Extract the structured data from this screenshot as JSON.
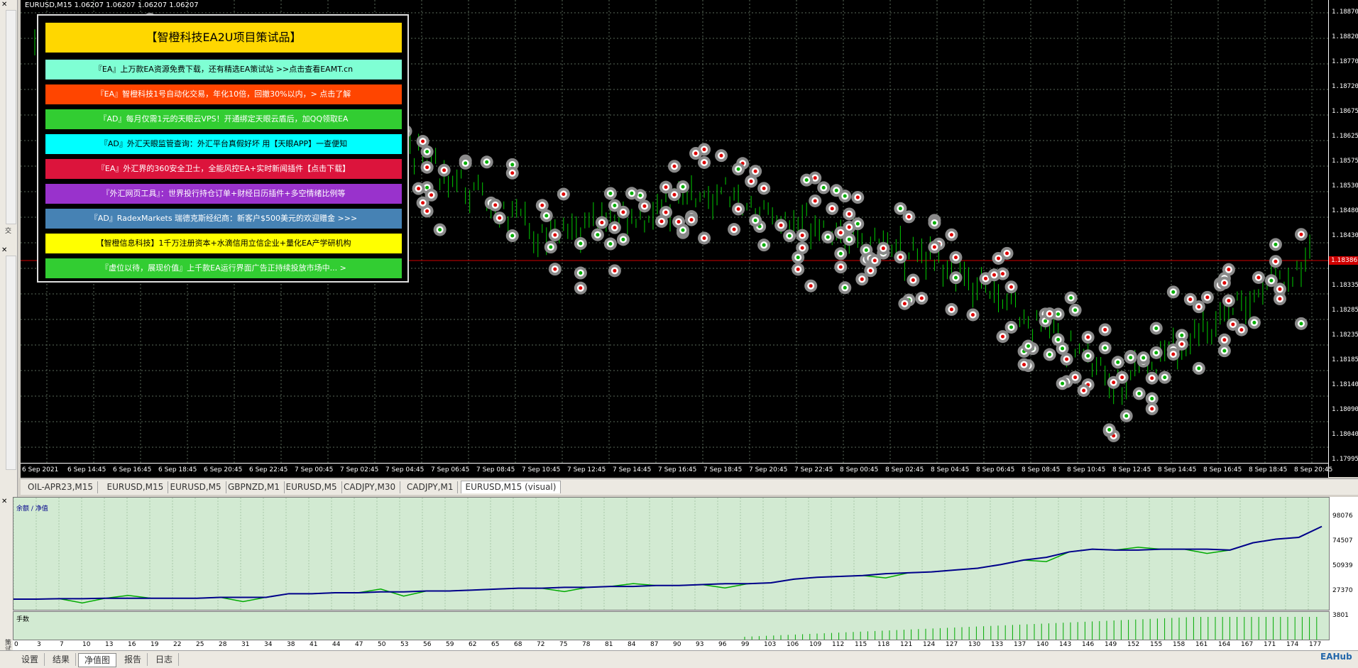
{
  "chart": {
    "title": "EURUSD,M15  1.06207 1.06207 1.06207 1.06207",
    "price_labels": [
      "1.18870",
      "1.18820",
      "1.18770",
      "1.18720",
      "1.18675",
      "1.18625",
      "1.18575",
      "1.18530",
      "1.18480",
      "1.18430",
      "1.18385",
      "1.18335",
      "1.18285",
      "1.18235",
      "1.18185",
      "1.18140",
      "1.18090",
      "1.18040",
      "1.17995"
    ],
    "current_price": "1.18386",
    "time_labels": [
      "6 Sep 2021",
      "6 Sep 14:45",
      "6 Sep 16:45",
      "6 Sep 18:45",
      "6 Sep 20:45",
      "6 Sep 22:45",
      "7 Sep 00:45",
      "7 Sep 02:45",
      "7 Sep 04:45",
      "7 Sep 06:45",
      "7 Sep 08:45",
      "7 Sep 10:45",
      "7 Sep 12:45",
      "7 Sep 14:45",
      "7 Sep 16:45",
      "7 Sep 18:45",
      "7 Sep 20:45",
      "7 Sep 22:45",
      "8 Sep 00:45",
      "8 Sep 02:45",
      "8 Sep 04:45",
      "8 Sep 06:45",
      "8 Sep 08:45",
      "8 Sep 10:45",
      "8 Sep 12:45",
      "8 Sep 14:45",
      "8 Sep 16:45",
      "8 Sep 18:45",
      "8 Sep 20:45"
    ],
    "colors": {
      "background": "#000000",
      "candle": "#00cc00",
      "grid": "#5a6a5a",
      "current_line": "#d00000"
    }
  },
  "ads": {
    "header": "【智橙科技EA2U项目策试品】",
    "rows": [
      {
        "text": "『EA』上万款EA资源免费下载，还有精选EA策试站 >>点击查看EAMT.cn",
        "bg": "#7fffd4",
        "fg": "#000000"
      },
      {
        "text": "『EA』智橙科技1号自动化交易，年化10倍，回撤30%以内，> 点击了解",
        "bg": "#ff4500",
        "fg": "#ffffff"
      },
      {
        "text": "『AD』每月仅需1元的天眼云VPS！开通绑定天眼云盾后，加QQ领取EA",
        "bg": "#32cd32",
        "fg": "#ffffff"
      },
      {
        "text": "『AD』外汇天眼监管查询：外汇平台真假好坏 用【天眼APP】一查便知",
        "bg": "#00ffff",
        "fg": "#000000"
      },
      {
        "text": "『EA』外汇界的360安全卫士，全能风控EA+实时新闻插件【点击下载】",
        "bg": "#dc143c",
        "fg": "#ffffff"
      },
      {
        "text": "『外汇网页工具』：世界投行持仓订单+财经日历插件+多空情绪比例等",
        "bg": "#9932cc",
        "fg": "#ffffff"
      },
      {
        "text": "『AD』RadexMarkets 瑞德克斯经纪商：新客户$500美元的欢迎赠金 >>>",
        "bg": "#4682b4",
        "fg": "#ffffff"
      },
      {
        "text": "【智橙信息科技】1千万注册资本+水滴信用立信企业+量化EA产学研机构",
        "bg": "#ffff00",
        "fg": "#000000"
      },
      {
        "text": "『虚位以待，展现价值』上千款EA运行界面广告正持续投放市场中... >",
        "bg": "#32cd32",
        "fg": "#ffffff"
      }
    ]
  },
  "tabs": [
    {
      "label": "OIL-APR23,M15",
      "active": false
    },
    {
      "label": "EURUSD,M15",
      "active": false
    },
    {
      "label": "EURUSD,M5",
      "active": false
    },
    {
      "label": "GBPNZD,M1",
      "active": false
    },
    {
      "label": "EURUSD,M5",
      "active": false
    },
    {
      "label": "CADJPY,M30",
      "active": false
    },
    {
      "label": "CADJPY,M1",
      "active": false
    },
    {
      "label": "EURUSD,M15 (visual)",
      "active": true
    }
  ],
  "tester": {
    "legend": "余额 / 净值",
    "lots_label": "手数",
    "equity_labels": [
      "98076",
      "74507",
      "50939",
      "27370",
      "3801"
    ],
    "x_labels": [
      "0",
      "3",
      "7",
      "10",
      "13",
      "16",
      "19",
      "22",
      "25",
      "28",
      "31",
      "34",
      "38",
      "41",
      "44",
      "47",
      "50",
      "53",
      "56",
      "59",
      "62",
      "65",
      "68",
      "72",
      "75",
      "78",
      "81",
      "84",
      "87",
      "90",
      "93",
      "96",
      "99",
      "103",
      "106",
      "109",
      "112",
      "115",
      "118",
      "121",
      "124",
      "127",
      "130",
      "133",
      "137",
      "140",
      "143",
      "146",
      "149",
      "152",
      "155",
      "158",
      "161",
      "164",
      "167",
      "171",
      "174",
      "177"
    ],
    "balance_series": [
      0,
      0,
      0.005,
      0.005,
      0.01,
      0.01,
      0.01,
      0.01,
      0.01,
      0.02,
      0.02,
      0.02,
      0.06,
      0.06,
      0.07,
      0.07,
      0.08,
      0.08,
      0.09,
      0.09,
      0.1,
      0.11,
      0.12,
      0.12,
      0.13,
      0.13,
      0.14,
      0.14,
      0.15,
      0.15,
      0.16,
      0.17,
      0.17,
      0.18,
      0.22,
      0.24,
      0.25,
      0.26,
      0.28,
      0.29,
      0.3,
      0.32,
      0.34,
      0.38,
      0.43,
      0.46,
      0.52,
      0.55,
      0.54,
      0.54,
      0.55,
      0.55,
      0.55,
      0.54,
      0.62,
      0.66,
      0.68,
      0.8
    ],
    "colors": {
      "background": "#d2ead2",
      "balance": "#00008b",
      "equity": "#00aa00"
    }
  },
  "bottom_tabs": [
    {
      "label": "设置",
      "active": false
    },
    {
      "label": "结果",
      "active": false
    },
    {
      "label": "净值图",
      "active": true
    },
    {
      "label": "报告",
      "active": false
    },
    {
      "label": "日志",
      "active": false
    }
  ],
  "side": {
    "label_top": "交",
    "label_bottom": "策试"
  },
  "watermark": "EAHub"
}
